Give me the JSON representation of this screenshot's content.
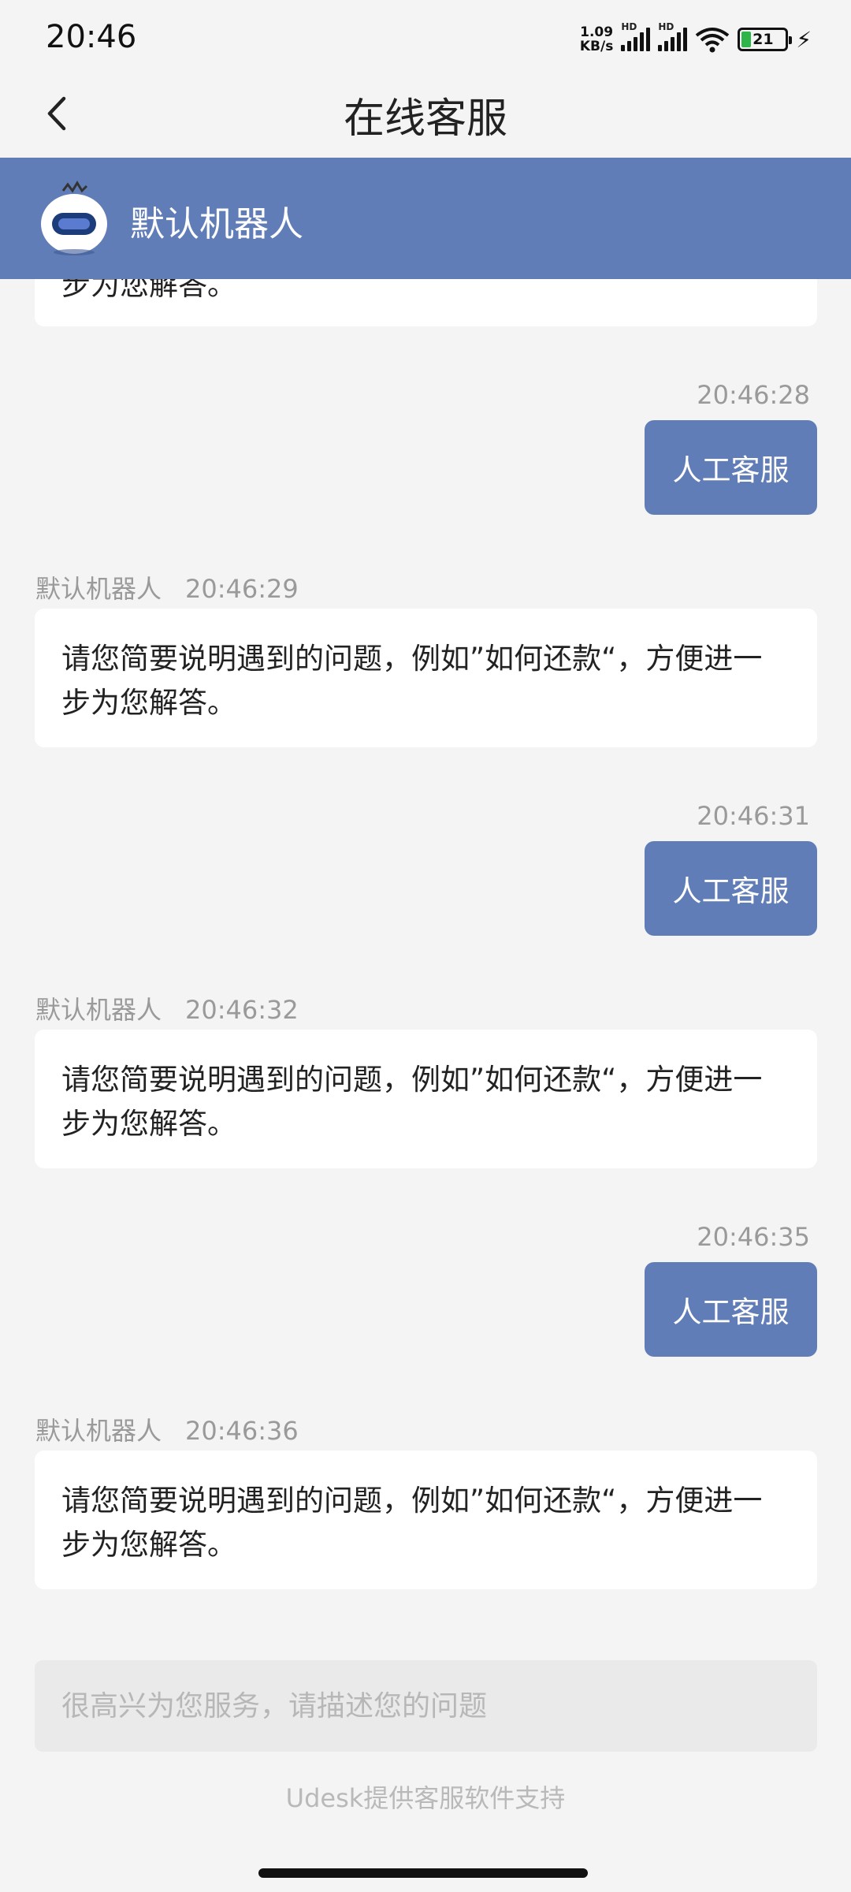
{
  "status": {
    "time": "20:46",
    "net_speed_value": "1.09",
    "net_speed_unit": "KB/s",
    "signal1_label": "HD",
    "signal2_label": "HD",
    "battery": "21"
  },
  "nav": {
    "title": "在线客服"
  },
  "agent": {
    "name": "默认机器人"
  },
  "messages": [
    {
      "from": "bot",
      "text": "步为您解答。"
    },
    {
      "from": "user",
      "time": "20:46:28",
      "text": "人工客服"
    },
    {
      "from": "bot",
      "sender": "默认机器人",
      "time": "20:46:29",
      "text": "请您简要说明遇到的问题，例如”如何还款“，方便进一步为您解答。"
    },
    {
      "from": "user",
      "time": "20:46:31",
      "text": "人工客服"
    },
    {
      "from": "bot",
      "sender": "默认机器人",
      "time": "20:46:32",
      "text": "请您简要说明遇到的问题，例如”如何还款“，方便进一步为您解答。"
    },
    {
      "from": "user",
      "time": "20:46:35",
      "text": "人工客服"
    },
    {
      "from": "bot",
      "sender": "默认机器人",
      "time": "20:46:36",
      "text": "请您简要说明遇到的问题，例如”如何还款“，方便进一步为您解答。"
    }
  ],
  "input": {
    "placeholder": "很高兴为您服务，请描述您的问题"
  },
  "footer": {
    "powered_by": "Udesk提供客服软件支持"
  },
  "colors": {
    "accent": "#607db7",
    "background": "#f4f4f4",
    "bubble_bot": "#ffffff",
    "timestamp": "#9a9a9a"
  }
}
